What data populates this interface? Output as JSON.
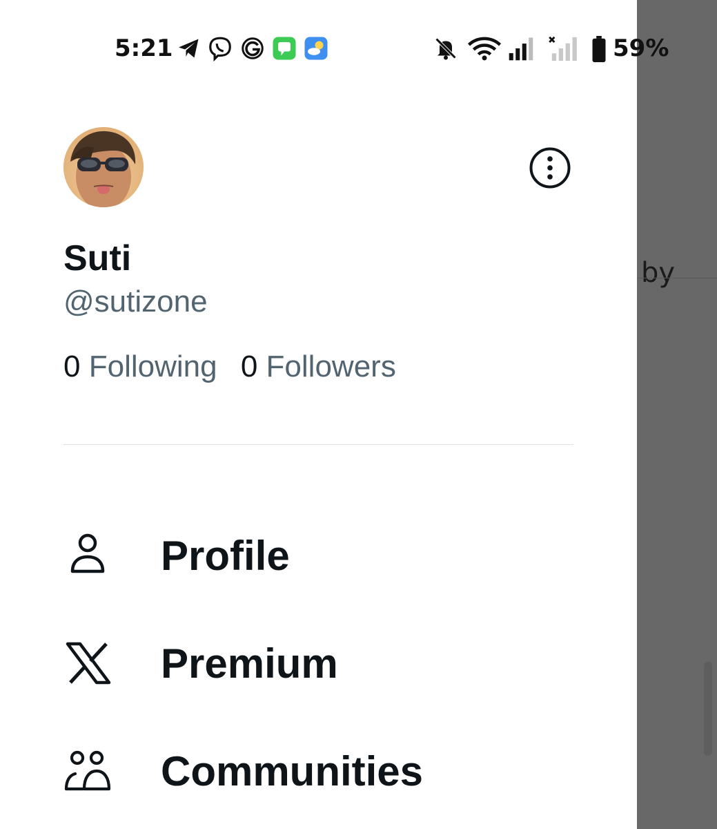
{
  "status_bar": {
    "time": "5:21",
    "battery": "59%",
    "notification_icons": [
      "telegram-icon",
      "viber-icon",
      "g-icon",
      "messages-icon",
      "weather-icon"
    ],
    "system_icons": [
      "bell-muted-icon",
      "wifi-icon",
      "signal-icon",
      "signal-no-service-icon",
      "battery-icon"
    ]
  },
  "profile": {
    "display_name": "Suti",
    "handle": "@sutizone",
    "following_count": "0",
    "following_label": "Following",
    "followers_count": "0",
    "followers_label": "Followers"
  },
  "nav": {
    "items": [
      {
        "label": "Profile",
        "icon": "person-icon"
      },
      {
        "label": "Premium",
        "icon": "x-logo-icon"
      },
      {
        "label": "Communities",
        "icon": "communities-icon"
      }
    ]
  },
  "background": {
    "partial_text": "by"
  },
  "colors": {
    "text_primary": "#0f1419",
    "text_secondary": "#536471",
    "overlay": "#686868",
    "divider": "#dbe0e4"
  }
}
